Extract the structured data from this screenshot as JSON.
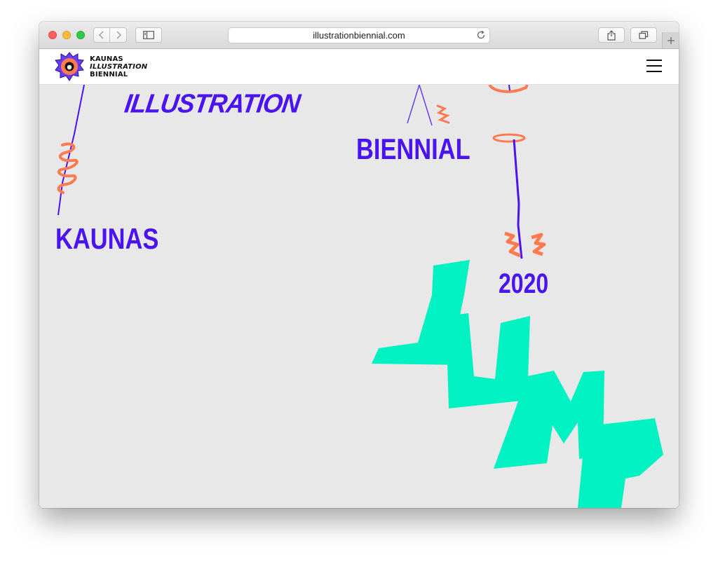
{
  "browser": {
    "url": "illustrationbiennial.com",
    "icons": {
      "back": "chevron-left-icon",
      "forward": "chevron-right-icon",
      "sidebar": "sidebar-icon",
      "reload": "reload-icon",
      "share": "share-icon",
      "tabs": "tabs-icon",
      "new_tab": "plus-icon"
    }
  },
  "site": {
    "logo": {
      "line1": "KAUNAS",
      "line2": "ILLUSTRATION",
      "line3": "BIENNIAL"
    },
    "menu_icon": "hamburger-icon"
  },
  "hero": {
    "word_illustration": "ILLUSTRATION",
    "word_biennial": "BIENNIAL",
    "word_kaunas": "KAUNAS",
    "year": "2020",
    "theme_word": "JUMP",
    "colors": {
      "text": "#4a14f0",
      "accent_orange": "#ff7a50",
      "accent_mint": "#00f2c3",
      "background": "#e8e8e8"
    }
  }
}
